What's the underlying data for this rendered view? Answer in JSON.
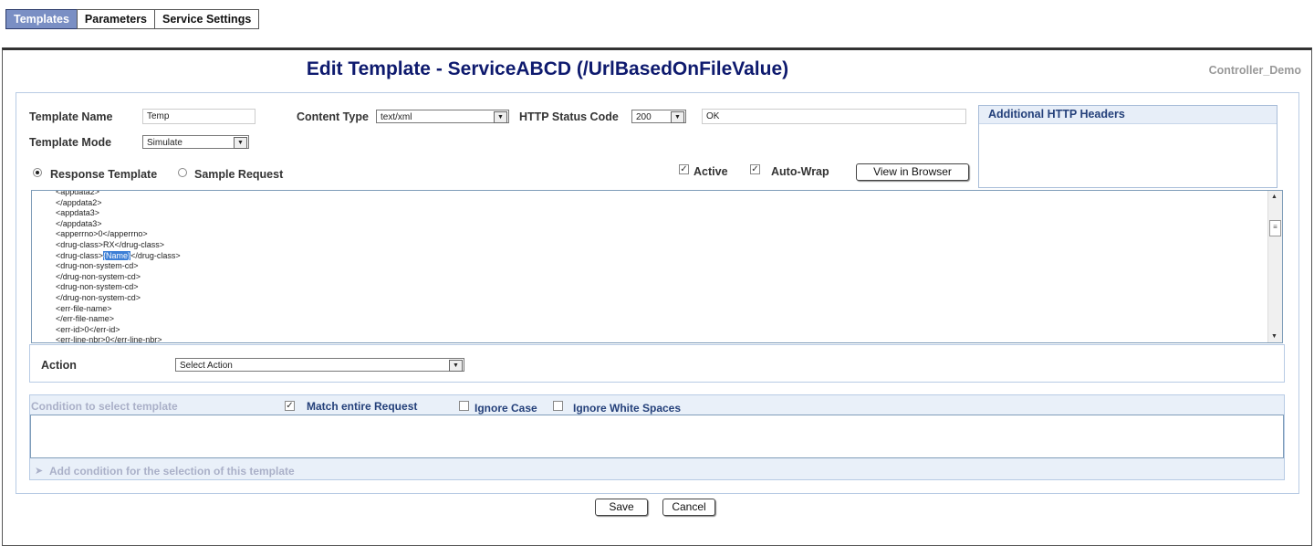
{
  "tabs": [
    {
      "label": "Templates",
      "active": true
    },
    {
      "label": "Parameters",
      "active": false
    },
    {
      "label": "Service Settings",
      "active": false
    }
  ],
  "page_title": "Edit Template - ServiceABCD (/UrlBasedOnFileValue)",
  "controller_name": "Controller_Demo",
  "form": {
    "template_name_label": "Template Name",
    "template_name_value": "Temp",
    "content_type_label": "Content Type",
    "content_type_value": "text/xml",
    "http_status_label": "HTTP Status Code",
    "http_status_value": "200",
    "http_status_text": "OK",
    "template_mode_label": "Template Mode",
    "template_mode_value": "Simulate"
  },
  "additional_headers_label": "Additional HTTP Headers",
  "mode_radios": {
    "response_template": "Response Template",
    "sample_request": "Sample Request"
  },
  "options": {
    "active_label": "Active",
    "autowrap_label": "Auto-Wrap",
    "view_browser_label": "View in Browser"
  },
  "editor": {
    "before_highlight": "<appdata2>\n</appdata2>\n<appdata3>\n</appdata3>\n<apperrno>0</apperrno>\n<drug-class>RX</drug-class>\n<drug-class>",
    "highlight": "{Name}",
    "after_highlight": "</drug-class>\n<drug-non-system-cd>\n</drug-non-system-cd>\n<drug-non-system-cd>\n</drug-non-system-cd>\n<err-file-name>\n</err-file-name>\n<err-id>0</err-id>\n<err-line-nbr>0</err-line-nbr>"
  },
  "action": {
    "label": "Action",
    "select_value": "Select Action"
  },
  "condition": {
    "header": "Condition to select template",
    "match_entire": "Match entire Request",
    "ignore_case": "Ignore Case",
    "ignore_whitespace": "Ignore White Spaces",
    "add_condition": "Add condition for the selection of this template"
  },
  "buttons": {
    "save": "Save",
    "cancel": "Cancel"
  },
  "colors": {
    "title": "#0e1a6e",
    "active_tab": "#7a8fc4",
    "header_accent": "#24407a"
  }
}
